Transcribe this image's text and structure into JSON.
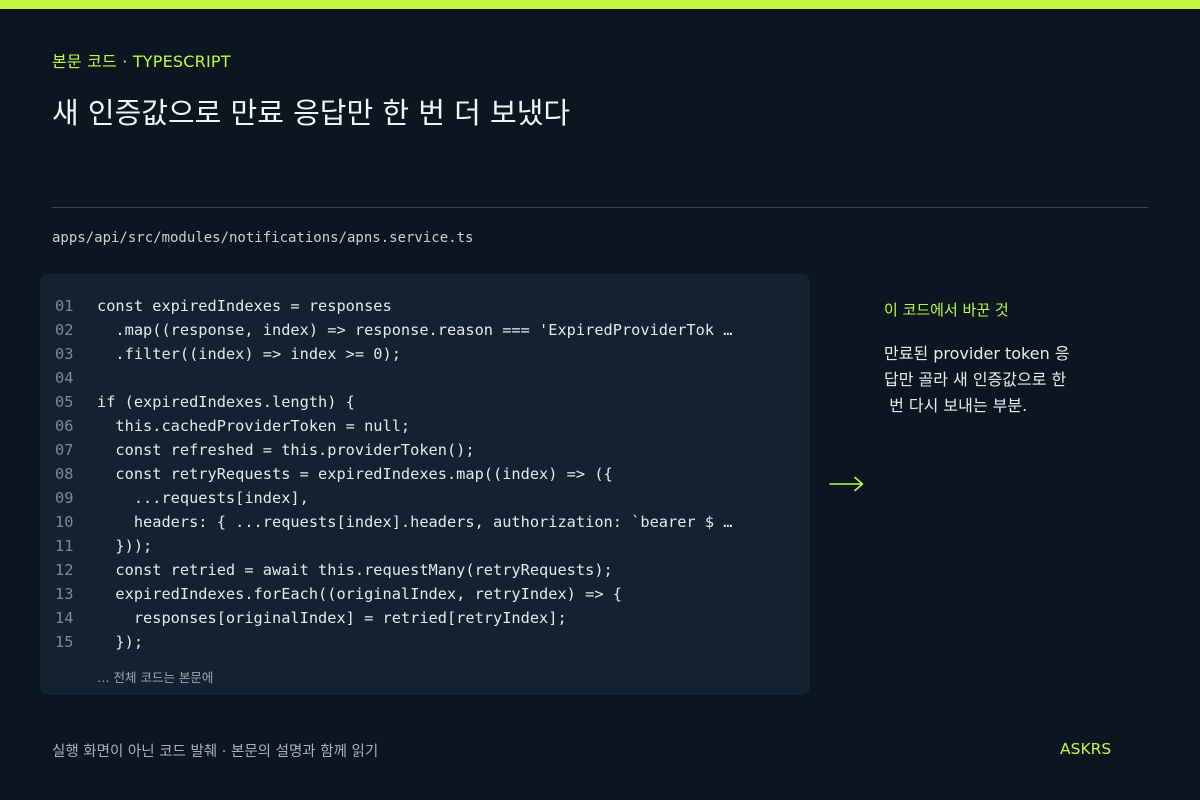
{
  "header": {
    "eyebrow": "본문 코드 · TYPESCRIPT",
    "title": "새 인증값으로 만료 응답만 한 번 더 보냈다"
  },
  "file": {
    "path": "apps/api/src/modules/notifications/apns.service.ts"
  },
  "code": {
    "lines": [
      {
        "num": "01",
        "text": "const expiredIndexes = responses"
      },
      {
        "num": "02",
        "text": "  .map((response, index) => response.reason === 'ExpiredProviderTok …"
      },
      {
        "num": "03",
        "text": "  .filter((index) => index >= 0);"
      },
      {
        "num": "04",
        "text": ""
      },
      {
        "num": "05",
        "text": "if (expiredIndexes.length) {"
      },
      {
        "num": "06",
        "text": "  this.cachedProviderToken = null;"
      },
      {
        "num": "07",
        "text": "  const refreshed = this.providerToken();"
      },
      {
        "num": "08",
        "text": "  const retryRequests = expiredIndexes.map((index) => ({"
      },
      {
        "num": "09",
        "text": "    ...requests[index],"
      },
      {
        "num": "10",
        "text": "    headers: { ...requests[index].headers, authorization: `bearer $ …"
      },
      {
        "num": "11",
        "text": "  }));"
      },
      {
        "num": "12",
        "text": "  const retried = await this.requestMany(retryRequests);"
      },
      {
        "num": "13",
        "text": "  expiredIndexes.forEach((originalIndex, retryIndex) => {"
      },
      {
        "num": "14",
        "text": "    responses[originalIndex] = retried[retryIndex];"
      },
      {
        "num": "15",
        "text": "  });"
      }
    ],
    "footnote": "… 전체 코드는 본문에"
  },
  "note": {
    "title": "이 코드에서 바꾼 것",
    "body_lines": [
      "만료된 provider token 응",
      "답만 골라 새 인증값으로 한",
      " 번 다시 보내는 부분."
    ]
  },
  "icons": {
    "arrow": "arrow-right-icon"
  },
  "footer": {
    "caption": "실행 화면이 아닌 코드 발췌 · 본문의 설명과 함께 읽기",
    "brand": "ASKRS"
  },
  "colors": {
    "accent": "#c5f543",
    "background": "#0b1620",
    "panel": "#132230"
  }
}
